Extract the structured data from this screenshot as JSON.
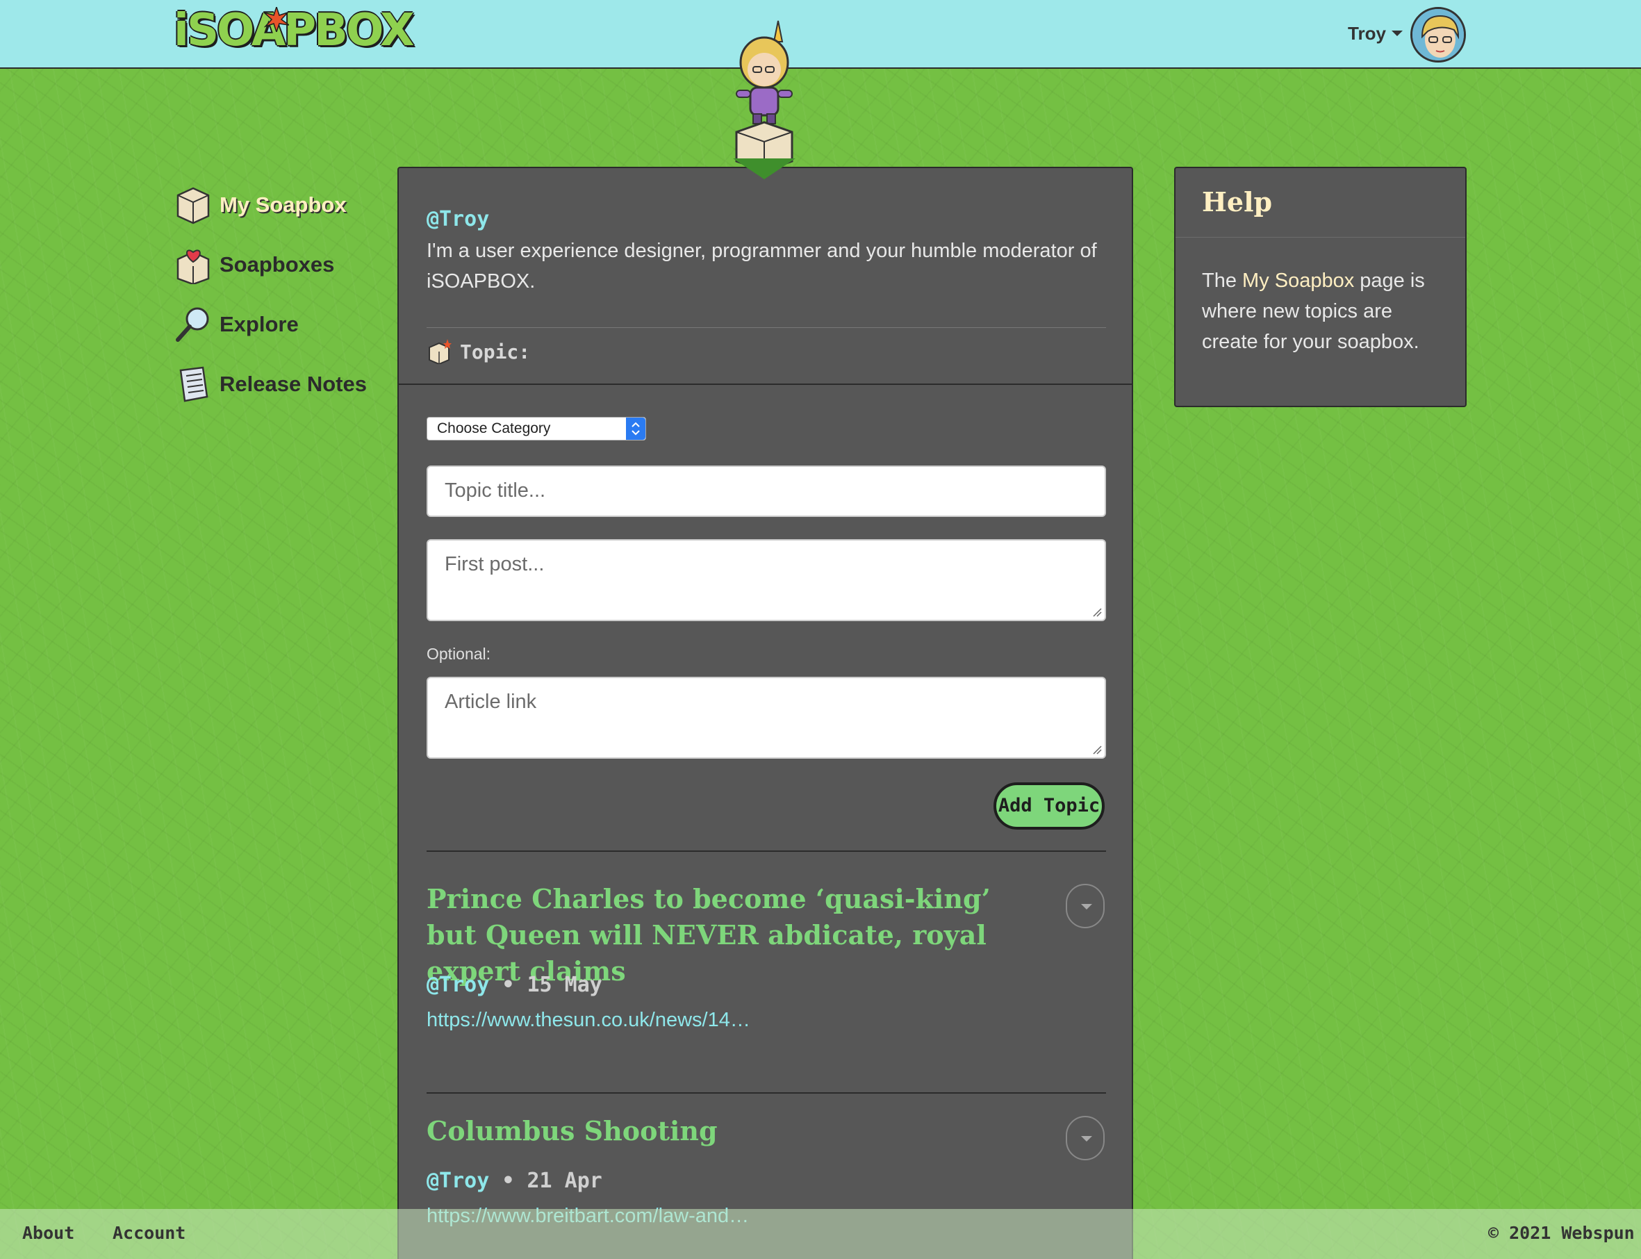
{
  "header": {
    "logo_text": "iSOAPBOX",
    "user_name": "Troy"
  },
  "nav": {
    "items": [
      {
        "label": "My Soapbox",
        "icon": "soapbox-box-icon",
        "active": true
      },
      {
        "label": "Soapboxes",
        "icon": "soapbox-heart-icon",
        "active": false
      },
      {
        "label": "Explore",
        "icon": "magnifier-icon",
        "active": false
      },
      {
        "label": "Release Notes",
        "icon": "notebook-icon",
        "active": false
      }
    ]
  },
  "profile": {
    "handle": "@Troy",
    "bio": "I'm a user experience designer, programmer and your humble moderator of iSOAPBOX."
  },
  "form": {
    "topic_label": "Topic:",
    "category_selected": "Choose Category",
    "title_placeholder": "Topic title...",
    "post_placeholder": "First post...",
    "optional_label": "Optional:",
    "link_placeholder": "Article link",
    "submit_label": "Add Topic"
  },
  "topics": [
    {
      "title": "Prince Charles to become ‘quasi-king’ but Queen will NEVER abdicate, royal expert claims",
      "author": "@Troy",
      "date": "15 May",
      "link": "https://www.thesun.co.uk/news/14…"
    },
    {
      "title": "Columbus Shooting",
      "author": "@Troy",
      "date": "21 Apr",
      "link": "https://www.breitbart.com/law-and…"
    }
  ],
  "help": {
    "title": "Help",
    "body_pre": "The ",
    "body_link": "My Soapbox",
    "body_post": " page is where new topics are create for your soapbox."
  },
  "footer": {
    "links": [
      "About",
      "Account"
    ],
    "copyright": "© 2021 Webspun"
  },
  "colors": {
    "background_green": "#74c043",
    "header_cyan": "#9ee8ea",
    "panel_gray": "#575757",
    "accent_green": "#7ed67b",
    "handle_cyan": "#8ee7ea",
    "highlight_cream": "#ffefc2"
  }
}
